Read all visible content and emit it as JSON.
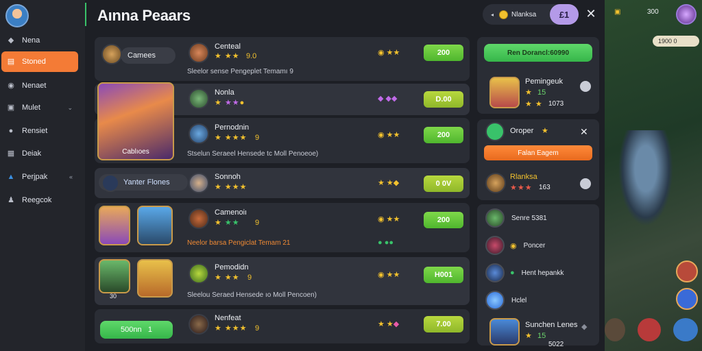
{
  "title": "Aınna Peaars",
  "topbar": {
    "name": "Nlanksa",
    "pill": "£1"
  },
  "sidebar": {
    "items": [
      {
        "label": "Nena",
        "icon": "shield-icon"
      },
      {
        "label": "Stoned",
        "icon": "store-icon",
        "active": true
      },
      {
        "label": "Nenaet",
        "icon": "chat-icon"
      },
      {
        "label": "Mulet",
        "icon": "cart-icon",
        "chev": "⌄"
      },
      {
        "label": "Rensiet",
        "icon": "pin-icon"
      },
      {
        "label": "Deiak",
        "icon": "trophy-icon"
      },
      {
        "label": "Perjpak",
        "icon": "home-icon",
        "chev": "«"
      },
      {
        "label": "Reegcok",
        "icon": "group-icon"
      }
    ]
  },
  "rows": [
    {
      "tag": "Camees",
      "name": "Centeal",
      "rating": "9.0",
      "price": "200",
      "desc": "Sleelor sense Pengeplet Temamı 9"
    },
    {
      "name": "Nonla",
      "price": "D.00"
    },
    {
      "name": "Pernodnin",
      "rating": "9",
      "price": "200",
      "desc": "Stselun Seraeel Hensede tc Moll Penoeoe)"
    },
    {
      "tag": "Yanter Flones",
      "name": "Sonnoh",
      "price": "0 0V"
    },
    {
      "name": "Camenoiı",
      "rating": "9",
      "price": "200",
      "desc": "Neelor barsa Pengiclat Temam 21"
    },
    {
      "name": "Pemodidn",
      "rating": "9",
      "price": "H001",
      "desc": "Sleelou Seraed Hensede ıo Moll Pencoen)"
    },
    {
      "name": "Nenfeat",
      "rating": "9",
      "price": "7.00"
    }
  ],
  "hero_cards": {
    "main": "Cablıoes",
    "g1": "",
    "g2": "",
    "g3": "30",
    "g4": ""
  },
  "green_pill": {
    "label": "500nn",
    "num": "1"
  },
  "right": {
    "top_button": "Ren Dorancl:60990",
    "item1": {
      "name": "Pemingeuk",
      "n1": "15",
      "n2": "1073"
    },
    "item2": {
      "name": "Oroper",
      "button": "Falan Eagem"
    },
    "item3": {
      "name": "Rlanksa",
      "n": "163"
    },
    "list": [
      {
        "label": "Senre 5381"
      },
      {
        "label": "Poncer"
      },
      {
        "label": "Hent hepankk"
      },
      {
        "label": "Hclel"
      },
      {
        "label": "Sunchen Lenes",
        "n1": "15",
        "n2": "5022"
      }
    ]
  },
  "game": {
    "coins": "300",
    "balance": "1900 0"
  }
}
